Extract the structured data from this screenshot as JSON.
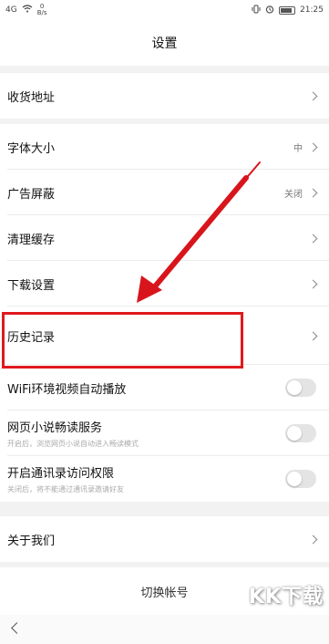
{
  "status_bar": {
    "signal": "4G",
    "net_speed": "0\nB/s",
    "time": "21:25"
  },
  "header": {
    "title": "设置"
  },
  "sections": {
    "address": {
      "label": "收货地址"
    },
    "font_size": {
      "label": "字体大小",
      "value": "中"
    },
    "ad_block": {
      "label": "广告屏蔽",
      "value": "关闭"
    },
    "clear_cache": {
      "label": "清理缓存"
    },
    "download_settings": {
      "label": "下载设置"
    },
    "history": {
      "label": "历史记录"
    },
    "wifi_autoplay": {
      "label": "WiFi环境视频自动播放",
      "enabled": false
    },
    "web_novel": {
      "label": "网页小说畅读服务",
      "sub": "开启后，浏览网页小说自动进入畅读模式",
      "enabled": false
    },
    "contacts": {
      "label": "开启通讯录访问权限",
      "sub": "关闭后，将不能通过通讯录邀请好友",
      "enabled": false
    },
    "about": {
      "label": "关于我们"
    }
  },
  "logout": {
    "label": "切换帐号"
  },
  "watermark": "KK下载",
  "colors": {
    "highlight": "#e1191d",
    "arrow": "#d9151c"
  }
}
